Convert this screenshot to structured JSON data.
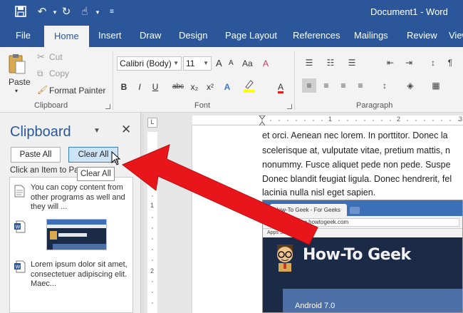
{
  "window": {
    "title": "Document1 - Word"
  },
  "tabs": [
    {
      "label": "File"
    },
    {
      "label": "Home"
    },
    {
      "label": "Insert"
    },
    {
      "label": "Draw"
    },
    {
      "label": "Design"
    },
    {
      "label": "Page Layout"
    },
    {
      "label": "References"
    },
    {
      "label": "Mailings"
    },
    {
      "label": "Review"
    },
    {
      "label": "View"
    }
  ],
  "ribbon": {
    "clipboard": {
      "paste_label": "Paste",
      "cut_label": "Cut",
      "copy_label": "Copy",
      "format_painter_label": "Format Painter",
      "group_label": "Clipboard"
    },
    "font": {
      "font_name": "Calibri (Body)",
      "font_size": "11",
      "grow_label": "A",
      "shrink_label": "A",
      "case_label": "Aa",
      "bold": "B",
      "italic": "I",
      "underline": "U",
      "strike": "abc",
      "subscript": "x₂",
      "superscript": "x²",
      "font_color_label": "A",
      "highlight_label": "A",
      "text_effect_label": "A",
      "group_label": "Font"
    },
    "paragraph": {
      "group_label": "Paragraph",
      "pilcrow": "¶"
    }
  },
  "clipboard_pane": {
    "title": "Clipboard",
    "paste_all_label": "Paste All",
    "clear_all_label": "Clear All",
    "hint": "Click an Item to Paste:",
    "tooltip": "Clear All",
    "items": [
      {
        "text": "You can copy content from other programs as well and they will ..."
      },
      {
        "text": "Lorem ipsum dolor sit amet, consectetuer adipiscing elit. Maec..."
      }
    ]
  },
  "ruler": {
    "h_marks": [
      "1",
      "2",
      "3"
    ],
    "v_marks": [
      "1",
      "2"
    ]
  },
  "document": {
    "lines": [
      "et orci. Aenean nec lorem. In porttitor. Donec la",
      "scelerisque at, vulputate vitae, pretium mattis, n",
      "nonummy. Fusce aliquet pede non pede. Suspe",
      "Donec blandit feugiat ligula. Donec hendrerit, fel",
      "lacinia nulla nisl eget sapien."
    ],
    "screenshot": {
      "tab_title": "How-To Geek - For Geeks",
      "url": "www.howtogeek.com",
      "bookmarks": "Apps      Settings",
      "logo": "How-To Geek",
      "card_text": "Android 7.0"
    }
  },
  "colors": {
    "accent": "#2b579a",
    "arrow": "#e8161b"
  }
}
